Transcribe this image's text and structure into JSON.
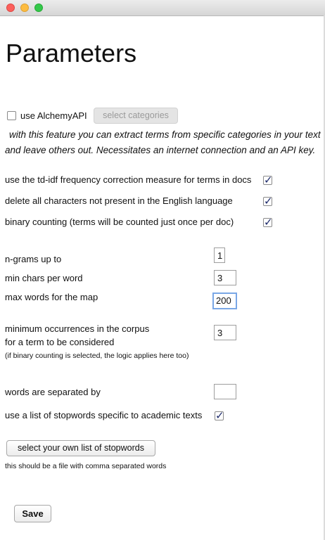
{
  "window": {
    "title": ""
  },
  "heading": "Parameters",
  "alchemy": {
    "checkbox_label": "use AlchemyAPI",
    "checked": false,
    "select_categories_label": "select categories",
    "description_line1": "with this feature you can extract terms from specific categories in your text",
    "description_line2": "and leave others out. Necessitates an internet connection and an API key."
  },
  "options": [
    {
      "label": "use the td-idf frequency correction measure for terms in docs",
      "checked": true
    },
    {
      "label": "delete all characters not present in the English language",
      "checked": true
    },
    {
      "label": "binary counting (terms will be counted just once per doc)",
      "checked": true
    }
  ],
  "params": {
    "ngrams_label": "n-grams up to",
    "ngrams_value": "1",
    "min_chars_label": "min chars per word",
    "min_chars_value": "3",
    "max_words_label": "max words for the map",
    "max_words_value": "200",
    "min_occ_label_line1": "minimum occurrences in the corpus",
    "min_occ_label_line2": "for a term to be considered",
    "min_occ_note": "(if binary counting is selected, the logic applies here too)",
    "min_occ_value": "3",
    "separator_label": "words are separated by",
    "separator_value": ""
  },
  "stopwords": {
    "academic_label": "use a list of stopwords specific to academic texts",
    "academic_checked": true,
    "select_button_label": "select your own list of stopwords",
    "file_note": "this should be a file with comma separated words"
  },
  "save_label": "Save"
}
